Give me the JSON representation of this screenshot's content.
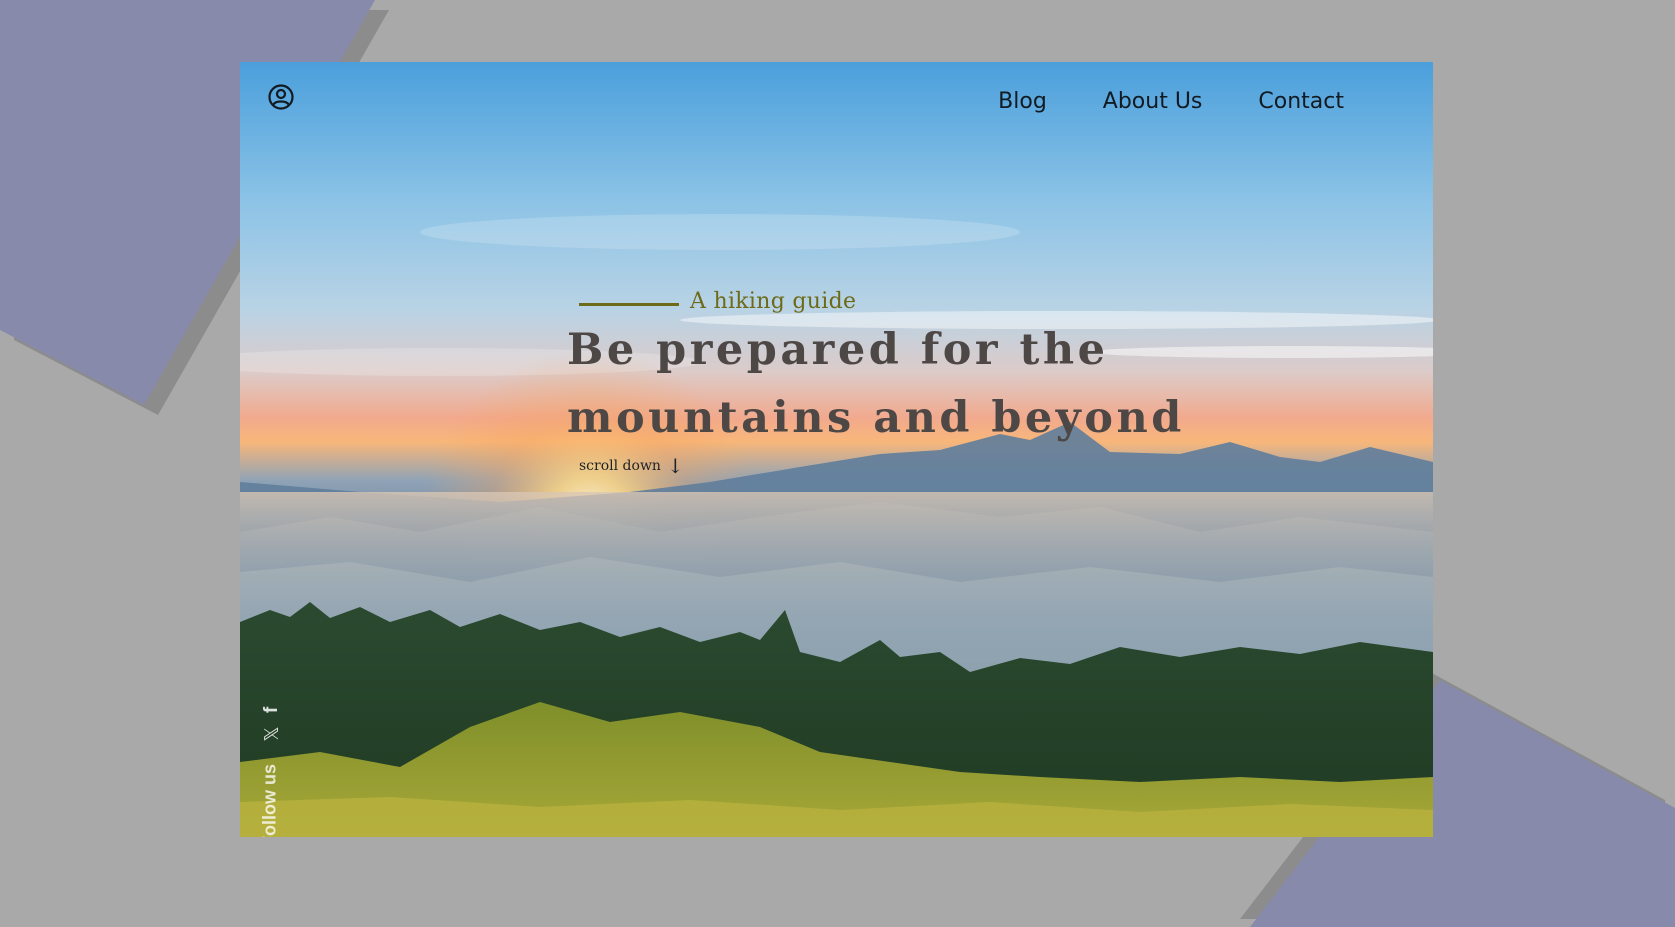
{
  "nav": {
    "items": [
      {
        "label": "Blog"
      },
      {
        "label": "About Us"
      },
      {
        "label": "Contact"
      }
    ]
  },
  "hero": {
    "eyebrow": "A hiking guide",
    "headline_line1": "Be prepared for the",
    "headline_line2": "mountains and beyond",
    "scroll_label": "scroll down",
    "scroll_arrow": "↓"
  },
  "social": {
    "follow_label": "Follow us",
    "x_glyph": "𝕏",
    "facebook_glyph": "f"
  },
  "colors": {
    "background": "#a9a9aa",
    "shape": "#878aab",
    "eyebrow": "#6d6a18",
    "headline": "#4d4845",
    "nav_text": "#121a22"
  }
}
